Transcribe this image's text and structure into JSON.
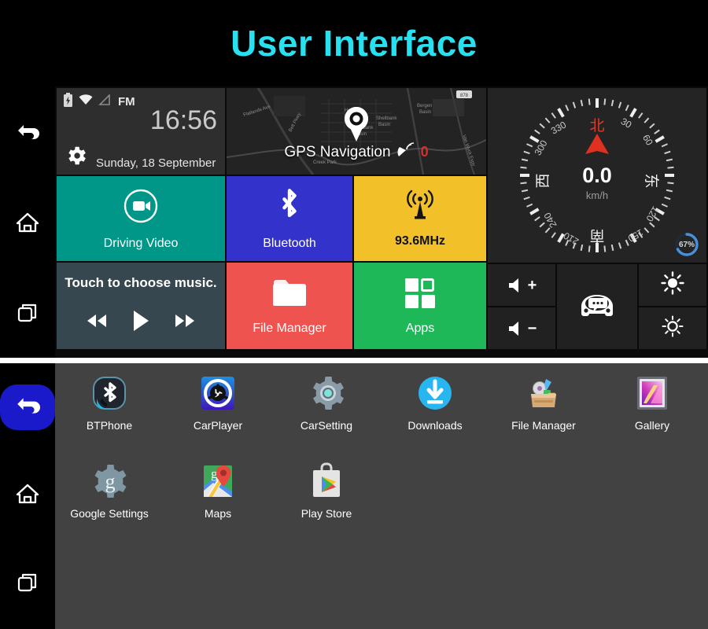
{
  "banner": {
    "title": "User Interface"
  },
  "screen1": {
    "nav": [
      {
        "name": "back",
        "icon": "back-arrow-icon"
      },
      {
        "name": "home",
        "icon": "home-icon"
      },
      {
        "name": "recents",
        "icon": "recent-apps-icon"
      }
    ],
    "clock": {
      "status_icons": [
        "battery-charging-icon",
        "wifi-icon",
        "signal-icon"
      ],
      "source": "FM",
      "time": "16:56",
      "date": "Sunday, 18 September",
      "settings_icon": "gear-icon"
    },
    "gps": {
      "label": "GPS Navigation",
      "satellite_icon": "satellite-dish-icon",
      "satellite_count": "0",
      "pin_icon": "map-pin-icon"
    },
    "compass": {
      "speed": "0.0",
      "unit": "km/h",
      "battery_pct": "67%",
      "battery_value": 67,
      "cardinals": [
        "北",
        "东",
        "南",
        "西"
      ],
      "degree_ticks": [
        "30",
        "60",
        "120",
        "150",
        "210",
        "240",
        "300",
        "330"
      ],
      "needle_color": "#e03020"
    },
    "tiles": [
      {
        "label": "Driving Video",
        "icon": "video-camera-icon",
        "color": "#009688"
      },
      {
        "label": "Bluetooth",
        "icon": "bluetooth-icon",
        "color": "#3333cc"
      },
      {
        "label": "93.6MHz",
        "icon": "radio-tower-icon",
        "color": "#f2c029"
      },
      {
        "label": "File Manager",
        "icon": "folder-icon",
        "color": "#ef5350"
      },
      {
        "label": "Apps",
        "icon": "apps-grid-icon",
        "color": "#1eb859"
      }
    ],
    "music": {
      "title": "Touch to choose music.",
      "controls": [
        "previous-icon",
        "play-icon",
        "next-icon"
      ]
    },
    "quick": [
      {
        "name": "volume-up",
        "icon": "speaker-icon",
        "sign": "+"
      },
      {
        "name": "volume-down",
        "icon": "speaker-icon",
        "sign": "−"
      },
      {
        "name": "voice-assistant",
        "icon": "car-chat-icon"
      },
      {
        "name": "brightness-up",
        "icon": "sun-bright-icon"
      },
      {
        "name": "brightness-down",
        "icon": "sun-dim-icon"
      }
    ]
  },
  "screen2": {
    "nav": [
      {
        "name": "back",
        "icon": "back-arrow-icon",
        "active": true
      },
      {
        "name": "home",
        "icon": "home-icon",
        "active": false
      },
      {
        "name": "recents",
        "icon": "recent-apps-icon",
        "active": false
      }
    ],
    "apps_row1": [
      {
        "label": "BTPhone",
        "icon": "bluetooth-phone-icon"
      },
      {
        "label": "CarPlayer",
        "icon": "car-player-icon"
      },
      {
        "label": "CarSetting",
        "icon": "car-setting-gear-icon"
      },
      {
        "label": "Downloads",
        "icon": "downloads-icon"
      },
      {
        "label": "File Manager",
        "icon": "file-manager-box-icon"
      },
      {
        "label": "Gallery",
        "icon": "gallery-icon"
      }
    ],
    "apps_row2": [
      {
        "label": "Google Settings",
        "icon": "google-settings-gear-icon"
      },
      {
        "label": "Maps",
        "icon": "google-maps-icon"
      },
      {
        "label": "Play Store",
        "icon": "play-store-icon"
      }
    ]
  },
  "colors": {
    "accent_cyan": "#28e0f0",
    "teal": "#009688",
    "indigo": "#3333cc",
    "yellow": "#f2c029",
    "red": "#ef5350",
    "green": "#1eb859",
    "slate": "#37474f",
    "drawer_bg": "#424242",
    "active_blue": "#1a1aca"
  }
}
